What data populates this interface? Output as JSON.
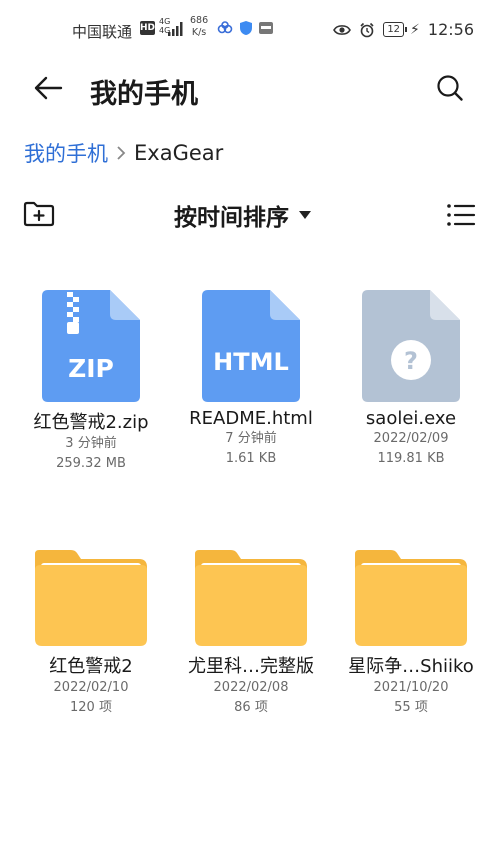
{
  "status_bar": {
    "carrier": "中国联通",
    "hd": "HD",
    "network": "4G",
    "network2": "4G",
    "speed_value": "686",
    "speed_unit": "K/s",
    "battery": "12",
    "time": "12:56"
  },
  "header": {
    "title": "我的手机",
    "back_icon": "arrow-left-icon",
    "search_icon": "search-icon"
  },
  "breadcrumb": {
    "root": "我的手机",
    "current": "ExaGear"
  },
  "toolbar": {
    "sort_label": "按时间排序",
    "new_folder_icon": "new-folder-icon",
    "list_view_icon": "list-view-icon"
  },
  "files": [
    {
      "name": "红色警戒2.zip",
      "date": "3 分钟前",
      "size": "259.32 MB",
      "type": "zip",
      "badge": "ZIP"
    },
    {
      "name": "README.html",
      "date": "7 分钟前",
      "size": "1.61 KB",
      "type": "html",
      "badge": "HTML"
    },
    {
      "name": "saolei.exe",
      "date": "2022/02/09",
      "size": "119.81 KB",
      "type": "unknown",
      "badge": "?"
    },
    {
      "name": "红色警戒2",
      "date": "2022/02/10",
      "size": "120 项",
      "type": "folder"
    },
    {
      "name": "尤里科…完整版",
      "date": "2022/02/08",
      "size": "86 项",
      "type": "folder"
    },
    {
      "name": "星际争…Shiiko",
      "date": "2021/10/20",
      "size": "55 项",
      "type": "folder"
    }
  ],
  "colors": {
    "accent": "#2f6fd6",
    "zip_blue": "#5e9cf2",
    "html_blue": "#5e9cf2",
    "unknown_gray": "#b3c2d4",
    "folder_yellow": "#fdc552"
  }
}
